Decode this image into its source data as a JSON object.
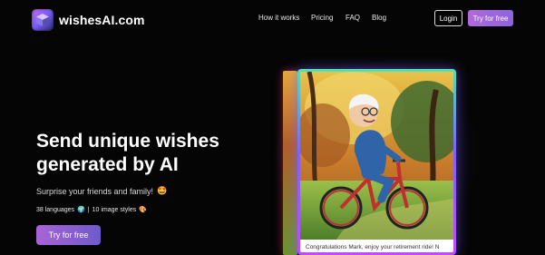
{
  "brand": {
    "name": "wishesAI.com",
    "logo_icon": "cube-logo-icon"
  },
  "nav": {
    "items": [
      "How it works",
      "Pricing",
      "FAQ",
      "Blog"
    ]
  },
  "header": {
    "login_label": "Login",
    "cta_label": "Try for free"
  },
  "hero": {
    "title": "Send unique wishes generated by AI",
    "subtitle": "Surprise your friends and family!",
    "subtitle_emoji": "🤩",
    "stats_languages": "38 languages",
    "stats_languages_emoji": "🌍",
    "stats_separator": "|",
    "stats_styles": "10 image styles",
    "stats_styles_emoji": "🎨",
    "cta_label": "Try for free"
  },
  "card": {
    "caption": "Congratulations Mark, enjoy your retirement ride! N",
    "image_subject": "elderly-man-on-bicycle-illustration"
  },
  "colors": {
    "accent": "#a864d6",
    "background": "#050505"
  }
}
